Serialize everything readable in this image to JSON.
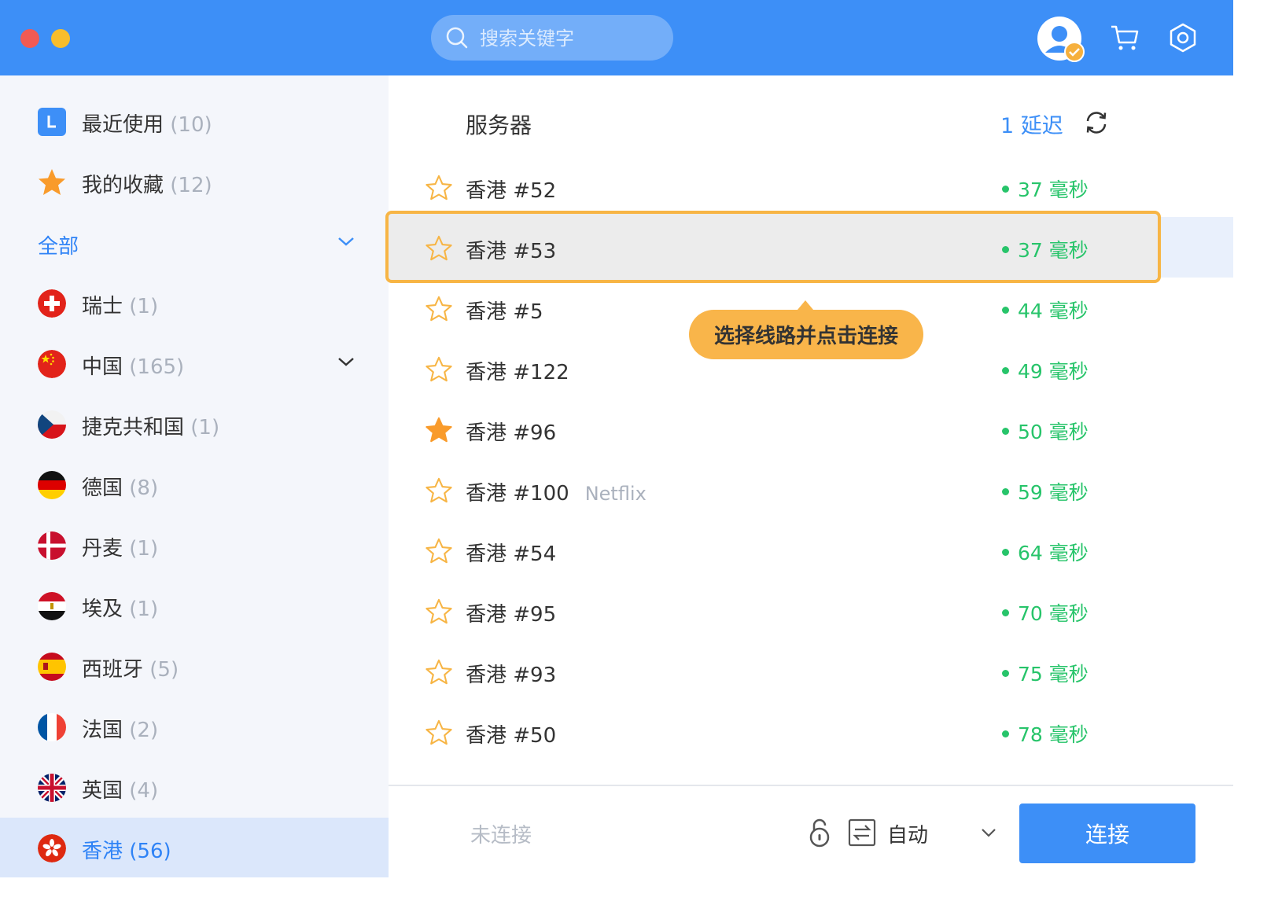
{
  "search": {
    "placeholder": "搜索关键字"
  },
  "sidebar": {
    "recent": {
      "label": "最近使用",
      "count": "(10)"
    },
    "favorites": {
      "label": "我的收藏",
      "count": "(12)"
    },
    "all_label": "全部",
    "countries": [
      {
        "label": "瑞士",
        "count": "(1)",
        "flag": "switzerland-flag"
      },
      {
        "label": "中国",
        "count": "(165)",
        "flag": "china-flag"
      },
      {
        "label": "捷克共和国",
        "count": "(1)",
        "flag": "czech-flag"
      },
      {
        "label": "德国",
        "count": "(8)",
        "flag": "germany-flag"
      },
      {
        "label": "丹麦",
        "count": "(1)",
        "flag": "denmark-flag"
      },
      {
        "label": "埃及",
        "count": "(1)",
        "flag": "egypt-flag"
      },
      {
        "label": "西班牙",
        "count": "(5)",
        "flag": "spain-flag"
      },
      {
        "label": "法国",
        "count": "(2)",
        "flag": "france-flag"
      },
      {
        "label": "英国",
        "count": "(4)",
        "flag": "uk-flag"
      },
      {
        "label": "香港",
        "count": "(56)",
        "flag": "hongkong-flag"
      }
    ]
  },
  "servers": {
    "title": "服务器",
    "sort_label": "1 延迟",
    "rows": [
      {
        "name": "香港 #52",
        "latency": "37 毫秒",
        "fav": false
      },
      {
        "name": "香港 #53",
        "latency": "37 毫秒",
        "fav": false
      },
      {
        "name": "香港 #5",
        "latency": "44 毫秒",
        "fav": false
      },
      {
        "name": "香港 #122",
        "latency": "49 毫秒",
        "fav": false
      },
      {
        "name": "香港 #96",
        "latency": "50 毫秒",
        "fav": true
      },
      {
        "name": "香港 #100",
        "tag": "Netflix",
        "latency": "59 毫秒",
        "fav": false
      },
      {
        "name": "香港 #54",
        "latency": "64 毫秒",
        "fav": false
      },
      {
        "name": "香港 #95",
        "latency": "70 毫秒",
        "fav": false
      },
      {
        "name": "香港 #93",
        "latency": "75 毫秒",
        "fav": false
      },
      {
        "name": "香港 #50",
        "latency": "78 毫秒",
        "fav": false
      }
    ]
  },
  "tooltip": "选择线路并点击连接",
  "footer": {
    "status": "未连接",
    "mode": "自动",
    "connect_label": "连接"
  },
  "colors": {
    "accent": "#3d8ff7",
    "latency_green": "#27c46a",
    "highlight_orange": "#f7b545",
    "sidebar_bg": "#f4f6fb"
  }
}
